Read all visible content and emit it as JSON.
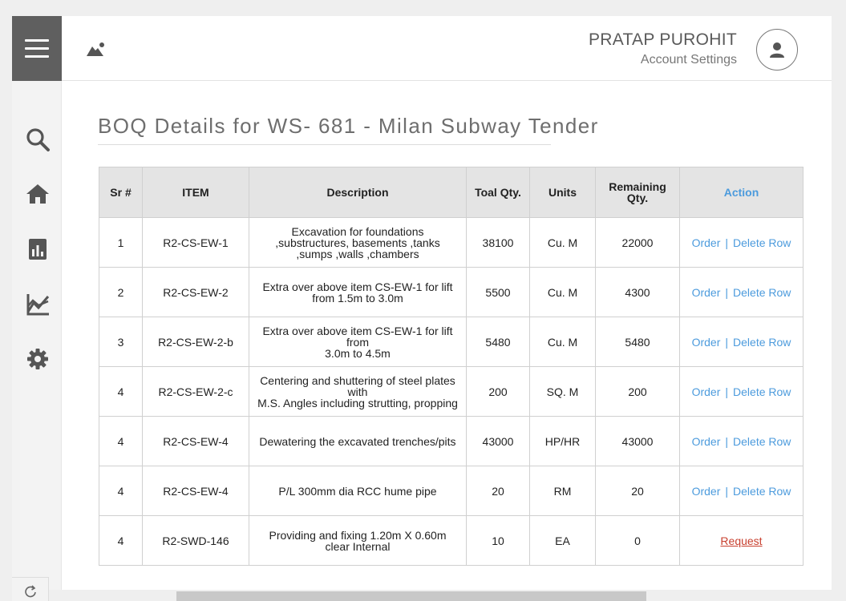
{
  "header": {
    "user_name": "PRATAP PUROHIT",
    "account_link": "Account Settings"
  },
  "sidebar": {
    "icons": [
      "search-icon",
      "home-icon",
      "report-icon",
      "chart-icon",
      "settings-icon"
    ]
  },
  "page": {
    "title": "BOQ Details for WS- 681 - Milan Subway Tender"
  },
  "table": {
    "headers": {
      "sr": "Sr #",
      "item": "ITEM",
      "description": "Description",
      "total_qty": "Toal Qty.",
      "units": "Units",
      "remaining_qty": "Remaining Qty.",
      "action": "Action"
    },
    "order_label": "Order",
    "separator": "|",
    "delete_label": "Delete Row",
    "request_label": "Request",
    "rows": [
      {
        "sr": "1",
        "item": "R2-CS-EW-1",
        "description": "Excavation for foundations ,substructures, basements ,tanks ,sumps ,walls ,chambers",
        "total_qty": "38100",
        "units": "Cu. M",
        "remaining_qty": "22000",
        "action": "order"
      },
      {
        "sr": "2",
        "item": "R2-CS-EW-2",
        "description": "Extra over above item CS-EW-1 for lift from 1.5m to 3.0m",
        "total_qty": "5500",
        "units": "Cu. M",
        "remaining_qty": "4300",
        "action": "order"
      },
      {
        "sr": "3",
        "item": "R2-CS-EW-2-b",
        "description": "Extra over above item CS-EW-1 for lift from\n3.0m to 4.5m",
        "total_qty": "5480",
        "units": "Cu. M",
        "remaining_qty": "5480",
        "action": "order"
      },
      {
        "sr": "4",
        "item": "R2-CS-EW-2-c",
        "description": "Centering and shuttering of steel plates with\nM.S. Angles including strutting, propping",
        "total_qty": "200",
        "units": "SQ. M",
        "remaining_qty": "200",
        "action": "order"
      },
      {
        "sr": "4",
        "item": "R2-CS-EW-4",
        "description": "Dewatering the excavated trenches/pits",
        "total_qty": "43000",
        "units": "HP/HR",
        "remaining_qty": "43000",
        "action": "order"
      },
      {
        "sr": "4",
        "item": "R2-CS-EW-4",
        "description": "P/L 300mm dia RCC hume pipe",
        "total_qty": "20",
        "units": "RM",
        "remaining_qty": "20",
        "action": "order"
      },
      {
        "sr": "4",
        "item": "R2-SWD-146",
        "description": "Providing and fixing 1.20m X 0.60m clear Internal",
        "total_qty": "10",
        "units": "EA",
        "remaining_qty": "0",
        "action": "request"
      }
    ]
  },
  "colors": {
    "link_blue": "#4c9bdd",
    "request_red": "#c8402f",
    "menu_bg": "#5f5f5f"
  }
}
